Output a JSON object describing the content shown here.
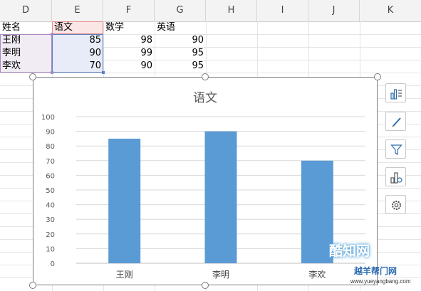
{
  "columns": [
    "D",
    "E",
    "F",
    "G",
    "H",
    "I",
    "J",
    "K"
  ],
  "sheet": {
    "headers": [
      "姓名",
      "语文",
      "数学",
      "英语"
    ],
    "rows": [
      {
        "name": "王刚",
        "chinese": "85",
        "math": "98",
        "english": "90"
      },
      {
        "name": "李明",
        "chinese": "90",
        "math": "99",
        "english": "95"
      },
      {
        "name": "李欢",
        "chinese": "70",
        "math": "90",
        "english": "95"
      }
    ]
  },
  "chart_data": {
    "type": "bar",
    "title": "语文",
    "categories": [
      "王刚",
      "李明",
      "李欢"
    ],
    "values": [
      85,
      90,
      70
    ],
    "ylim": [
      0,
      100
    ],
    "yticks": [
      0,
      10,
      20,
      30,
      40,
      50,
      60,
      70,
      80,
      90,
      100
    ],
    "grid": true,
    "bar_color": "#5b9bd5",
    "xlabel": "",
    "ylabel": ""
  },
  "toolbar": {
    "icons": [
      "chart-elements-icon",
      "chart-style-icon",
      "chart-filter-icon",
      "chart-type-icon",
      "chart-settings-icon"
    ]
  },
  "watermark": {
    "brand": "酷知网",
    "slogan": "越羊帮门网",
    "url": "www.yueyangbang.com"
  },
  "colors": {
    "accent_blue": "#5b7fc1",
    "accent_red": "#e38f8f",
    "name_select": "#a888c2"
  }
}
